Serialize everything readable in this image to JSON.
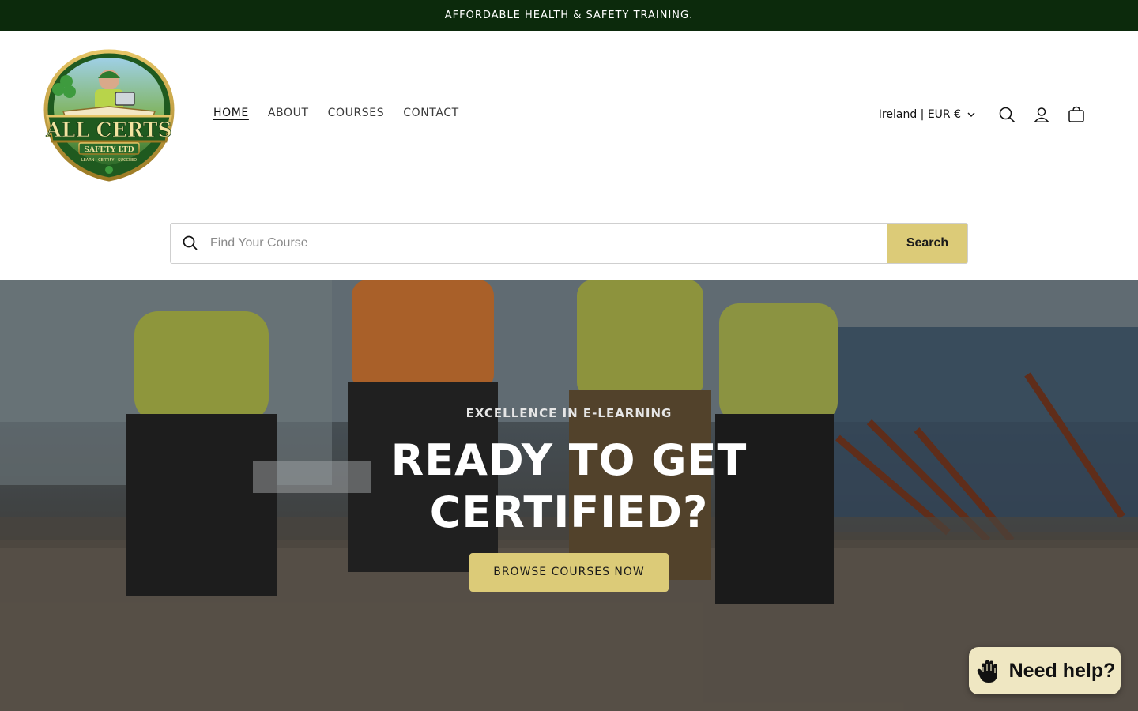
{
  "announcement": {
    "text": "AFFORDABLE HEALTH & SAFETY TRAINING."
  },
  "header": {
    "logo": {
      "line1": "ALL CERTS",
      "line2": "SAFETY LTD",
      "tagline": "LEARN · CERTIFY · SUCCEED"
    },
    "nav": [
      {
        "label": "HOME",
        "active": true
      },
      {
        "label": "ABOUT",
        "active": false
      },
      {
        "label": "COURSES",
        "active": false
      },
      {
        "label": "CONTACT",
        "active": false
      }
    ],
    "locale": "Ireland | EUR €",
    "icons": [
      "search-icon",
      "account-icon",
      "cart-icon"
    ]
  },
  "search": {
    "placeholder": "Find Your Course",
    "value": "",
    "button": "Search"
  },
  "hero": {
    "eyebrow": "EXCELLENCE IN E-LEARNING",
    "title": "READY TO GET CERTIFIED?",
    "cta": "BROWSE COURSES NOW"
  },
  "help_chat": {
    "label": "Need help?"
  },
  "colors": {
    "announcement_bg": "#0c2a0c",
    "accent": "#dccb78",
    "help_bg": "#efe7c2",
    "logo_green": "#1f5a1f",
    "logo_gold": "#c9a646"
  }
}
